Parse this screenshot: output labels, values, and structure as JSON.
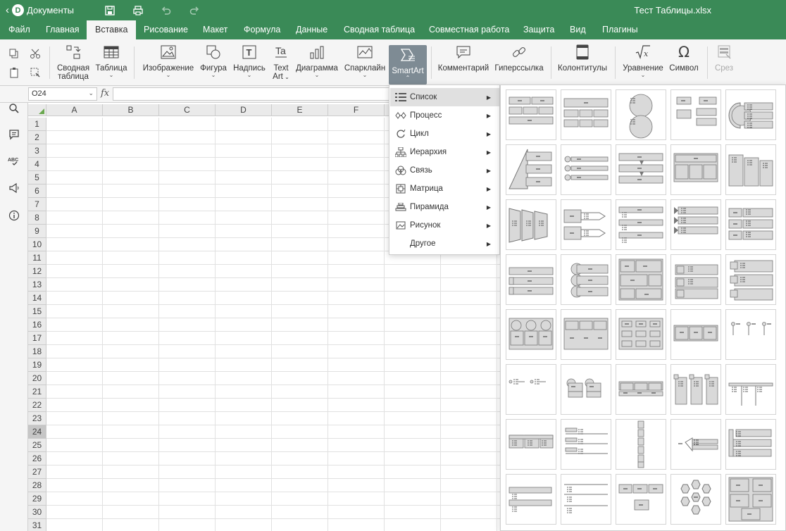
{
  "titlebar": {
    "back_label": "Документы",
    "document_title": "Тест Таблицы.xlsx"
  },
  "tabs": [
    "Файл",
    "Главная",
    "Вставка",
    "Рисование",
    "Макет",
    "Формула",
    "Данные",
    "Сводная таблица",
    "Совместная работа",
    "Защита",
    "Вид",
    "Плагины"
  ],
  "active_tab": "Вставка",
  "toolbar": {
    "pivot_label_1": "Сводная",
    "pivot_label_2": "таблица",
    "table_label": "Таблица",
    "image_label": "Изображение",
    "shape_label": "Фигура",
    "textbox_label": "Надпись",
    "textart_label_1": "Text",
    "textart_label_2": "Art",
    "chart_label": "Диаграмма",
    "sparkline_label": "Спарклайн",
    "smartart_label": "SmartArt",
    "comment_label": "Комментарий",
    "hyperlink_label": "Гиперссылка",
    "header_footer_label": "Колонтитулы",
    "equation_label": "Уравнение",
    "symbol_label": "Символ",
    "slicer_label": "Срез"
  },
  "formula_bar": {
    "cell_reference": "O24",
    "fx_label": "fx",
    "formula_value": ""
  },
  "grid": {
    "columns": [
      "A",
      "B",
      "C",
      "D",
      "E",
      "F"
    ],
    "rows": [
      "1",
      "2",
      "3",
      "4",
      "5",
      "6",
      "7",
      "8",
      "9",
      "10",
      "11",
      "12",
      "13",
      "14",
      "15",
      "16",
      "17",
      "18",
      "19",
      "20",
      "21",
      "22",
      "23",
      "24",
      "25",
      "26",
      "27",
      "28",
      "29",
      "30",
      "31"
    ],
    "selected_row": "24"
  },
  "smartart_menu": {
    "items": [
      "Список",
      "Процесс",
      "Цикл",
      "Иерархия",
      "Связь",
      "Матрица",
      "Пирамида",
      "Рисунок",
      "Другое"
    ],
    "active_item": "Список"
  },
  "colors": {
    "brand_green": "#3a8a57",
    "toolbar_bg": "#f5f5f5",
    "active_button": "#7e8b94",
    "tile_gray": "#d9d9d9"
  },
  "gallery": {
    "layout_count": 40
  }
}
